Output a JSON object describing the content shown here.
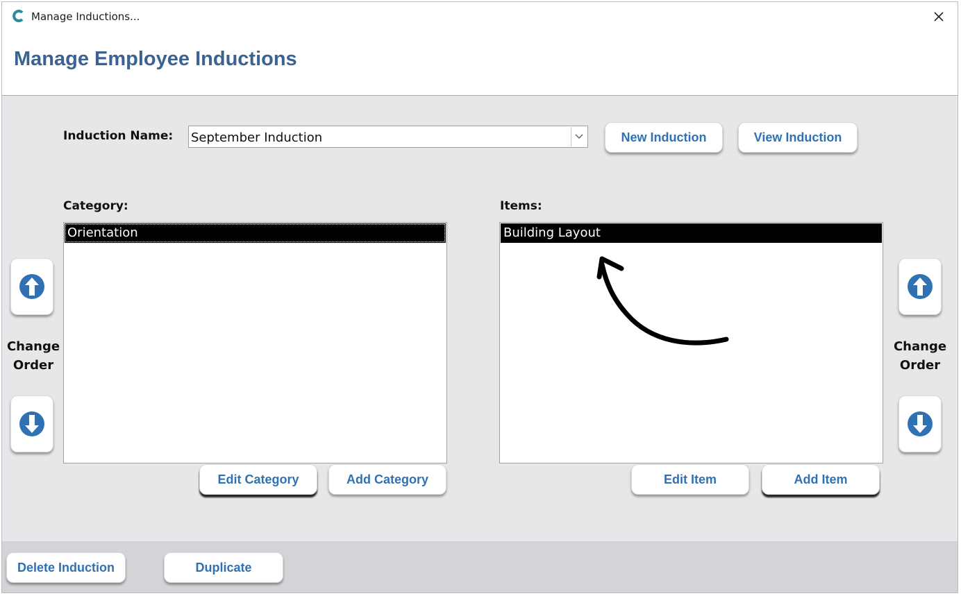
{
  "window": {
    "title": "Manage Inductions...",
    "app_icon": "c-logo-icon",
    "close_glyph": "✕"
  },
  "header": {
    "title": "Manage Employee Inductions"
  },
  "induction": {
    "label": "Induction Name:",
    "selected": "September Induction",
    "new_label": "New Induction",
    "view_label": "View Induction"
  },
  "category": {
    "label": "Category:",
    "items": [
      "Orientation"
    ],
    "edit_label": "Edit Category",
    "add_label": "Add Category"
  },
  "items": {
    "label": "Items:",
    "items": [
      "Building Layout"
    ],
    "edit_label": "Edit Item",
    "add_label": "Add Item"
  },
  "order": {
    "label_line1": "Change",
    "label_line2": "Order"
  },
  "footer": {
    "delete_label": "Delete Induction",
    "duplicate_label": "Duplicate"
  },
  "colors": {
    "accent": "#2f71b3",
    "title": "#3b6392",
    "selection": "#000000",
    "background": "#e6e7e9"
  }
}
